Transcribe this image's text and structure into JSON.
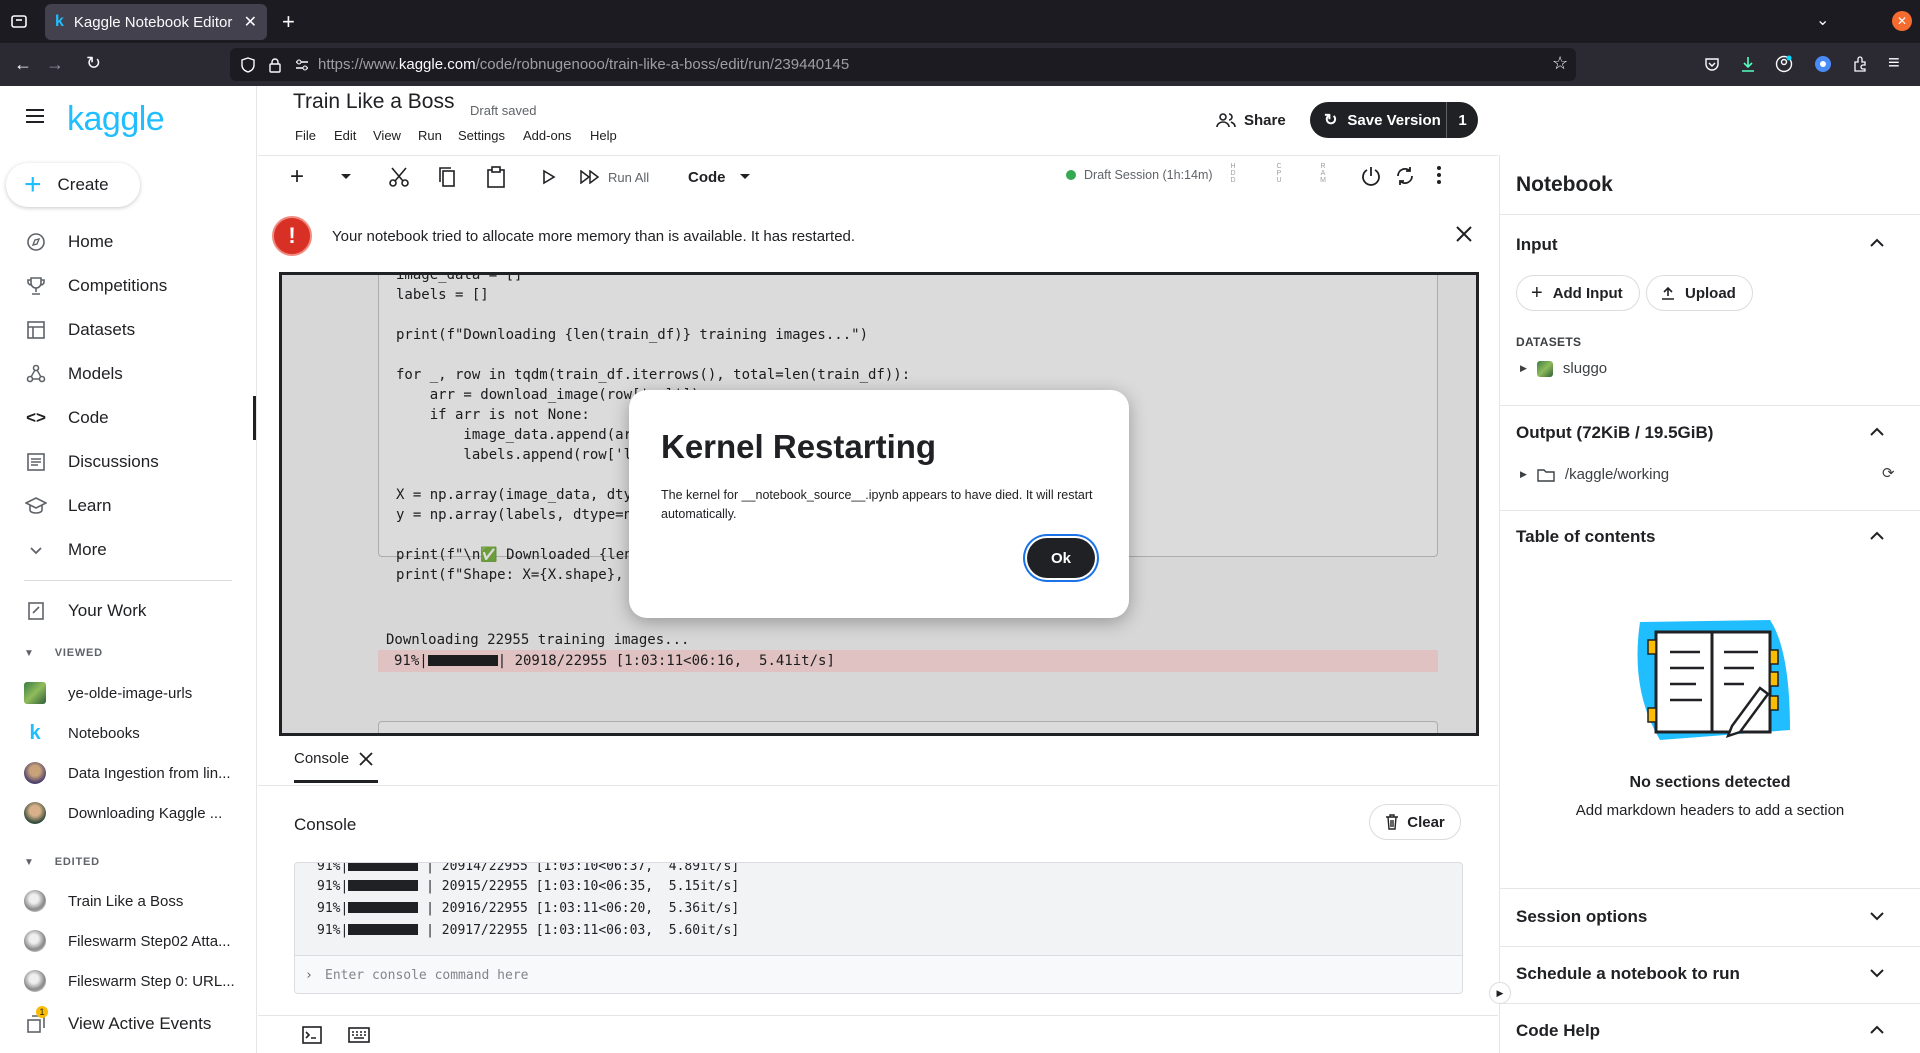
{
  "browser": {
    "tab_title": "Kaggle Notebook Editor",
    "url_prefix": "https://www.",
    "url_host": "kaggle.com",
    "url_path": "/code/robnugenooo/train-like-a-boss/edit/run/239440145"
  },
  "sidebar": {
    "logo": "kaggle",
    "create_label": "Create",
    "nav": [
      {
        "label": "Home",
        "icon": "home-icon"
      },
      {
        "label": "Competitions",
        "icon": "trophy-icon"
      },
      {
        "label": "Datasets",
        "icon": "table-icon"
      },
      {
        "label": "Models",
        "icon": "models-icon"
      },
      {
        "label": "Code",
        "icon": "code-icon"
      },
      {
        "label": "Discussions",
        "icon": "discussion-icon"
      },
      {
        "label": "Learn",
        "icon": "school-icon"
      },
      {
        "label": "More",
        "icon": "chevron-down-icon"
      }
    ],
    "your_work": "Your Work",
    "viewed_label": "VIEWED",
    "viewed": [
      "ye-olde-image-urls",
      "Notebooks",
      "Data Ingestion from lin...",
      "Downloading Kaggle ..."
    ],
    "edited_label": "EDITED",
    "edited": [
      "Train Like a Boss",
      "Fileswarm Step02 Atta...",
      "Fileswarm Step 0: URL..."
    ],
    "active_events": "View Active Events",
    "active_events_badge": "1"
  },
  "header": {
    "title": "Train Like a Boss",
    "status": "Draft saved",
    "menu": [
      "File",
      "Edit",
      "View",
      "Run",
      "Settings",
      "Add-ons",
      "Help"
    ],
    "share": "Share",
    "save_version": "Save Version",
    "version_count": "1"
  },
  "toolbar": {
    "run_all": "Run All",
    "cell_type": "Code",
    "session": "Draft Session (1h:14m)",
    "meters": [
      "HDD",
      "CPU",
      "RAM"
    ]
  },
  "banner": {
    "message": "Your notebook tried to allocate more memory than is available. It has restarted."
  },
  "notebook": {
    "code_lines": [
      "image_data = []",
      "labels = []",
      "",
      "print(f\"Downloading {len(train_df)} training images...\")",
      "",
      "for _, row in tqdm(train_df.iterrows(), total=len(train_df)):",
      "    arr = download_image(row['url'])",
      "    if arr is not None:",
      "        image_data.append(ar",
      "        labels.append(row['l",
      "",
      "X = np.array(image_data, dty",
      "y = np.array(labels, dtype=n",
      "",
      "print(f\"\\n✅ Downloaded {len",
      "print(f\"Shape: X={X.shape},"
    ],
    "output_line": "Downloading 22955 training images...",
    "progress_pct": "91%|",
    "progress_rest": "| 20918/22955 [1:03:11<06:16,  5.41it/s]",
    "progress_fraction": 0.91
  },
  "modal": {
    "title": "Kernel Restarting",
    "body": "The kernel for __notebook_source__.ipynb appears to have died. It will restart automatically.",
    "ok": "Ok"
  },
  "console": {
    "tab_label": "Console",
    "title": "Console",
    "clear": "Clear",
    "lines": [
      {
        "pct": "91%|",
        "rest": " | 20914/22955 [1:03:10<06:37,  4.89it/s]"
      },
      {
        "pct": "91%|",
        "rest": " | 20915/22955 [1:03:10<06:35,  5.15it/s]"
      },
      {
        "pct": "91%|",
        "rest": " | 20916/22955 [1:03:11<06:20,  5.36it/s]"
      },
      {
        "pct": "91%|",
        "rest": " | 20917/22955 [1:03:11<06:03,  5.60it/s]"
      }
    ],
    "input_placeholder": "Enter console command here"
  },
  "right_panel": {
    "title": "Notebook",
    "input_section": "Input",
    "add_input": "Add Input",
    "upload": "Upload",
    "datasets_label": "DATASETS",
    "dataset": "sluggo",
    "output_section": "Output (72KiB / 19.5GiB)",
    "output_path": "/kaggle/working",
    "toc_section": "Table of contents",
    "no_sections": "No sections detected",
    "no_sections_hint": "Add markdown headers to add a section",
    "session_options": "Session options",
    "schedule": "Schedule a notebook to run",
    "code_help": "Code Help"
  },
  "colors": {
    "kaggle_blue": "#20beff",
    "error_red": "#d93025",
    "session_green": "#34a853",
    "dark_button": "#202124"
  }
}
